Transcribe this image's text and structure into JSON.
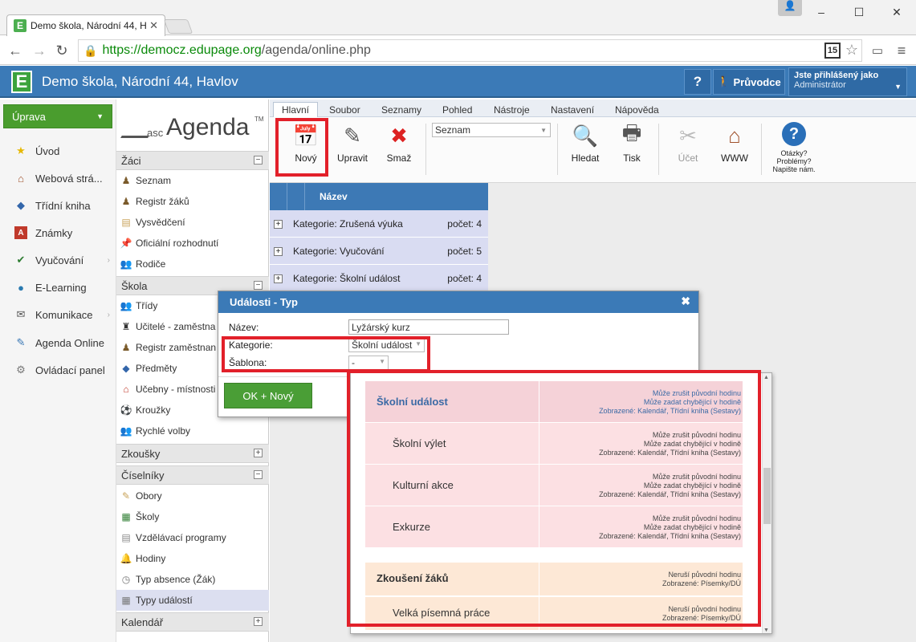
{
  "browser": {
    "tab_title": "Demo škola, Národní 44, H",
    "url_host": "https://democz.edupage.org",
    "url_path": "/agenda/online.php",
    "badge": "15",
    "win_min": "–",
    "win_max": "☐",
    "win_close": "✕"
  },
  "app": {
    "logo": "E",
    "title": "Demo škola, Národní 44, Havlov",
    "help": "?",
    "guide": "Průvodce",
    "login_label": "Jste přihlášený jako",
    "login_user": "Administrátor"
  },
  "leftnav": {
    "edit_button": "Úprava",
    "items": [
      {
        "label": "Úvod",
        "icon": "★"
      },
      {
        "label": "Webová strá...",
        "icon": "⌂"
      },
      {
        "label": "Třídní kniha",
        "icon": "◆"
      },
      {
        "label": "Známky",
        "icon": "A"
      },
      {
        "label": "Vyučování",
        "icon": "✔"
      },
      {
        "label": "E-Learning",
        "icon": "●"
      },
      {
        "label": "Komunikace",
        "icon": "✉"
      },
      {
        "label": "Agenda Online",
        "icon": "✎"
      },
      {
        "label": "Ovládací panel",
        "icon": "⚙"
      }
    ]
  },
  "agenda": {
    "logo_asc": "asc",
    "logo_name": "Agenda",
    "logo_tm": "TM",
    "sections": {
      "zaci": "Žáci",
      "skola": "Škola",
      "zkousky": "Zkoušky",
      "ciselniky": "Číselníky",
      "kalendar": "Kalendář"
    },
    "zaci_items": [
      "Seznam",
      "Registr žáků",
      "Vysvědčení",
      "Oficiální rozhodnutí",
      "Rodiče"
    ],
    "skola_items": [
      "Třídy",
      "Učitelé - zaměstna",
      "Registr zaměstnan",
      "Předměty",
      "Učebny - místnosti",
      "Kroužky",
      "Rychlé volby"
    ],
    "ciselniky_items": [
      "Obory",
      "Školy",
      "Vzdělávací programy",
      "Hodiny",
      "Typ absence (Žák)",
      "Typy událostí"
    ]
  },
  "ribbon": {
    "tabs": [
      "Hlavní",
      "Soubor",
      "Seznamy",
      "Pohled",
      "Nástroje",
      "Nastavení",
      "Nápověda"
    ],
    "buttons": {
      "novy": "Nový",
      "upravit": "Upravit",
      "smaz": "Smaž",
      "hledat": "Hledat",
      "tisk": "Tisk",
      "ucet": "Účet",
      "www": "WWW",
      "help1": "Otázky?",
      "help2": "Problémy?",
      "help3": "Napište nám."
    },
    "select": "Seznam"
  },
  "grid": {
    "header": "Název",
    "rows": [
      {
        "name": "Kategorie: Zrušená výuka",
        "count": "počet: 4"
      },
      {
        "name": "Kategorie: Vyučování",
        "count": "počet: 5"
      },
      {
        "name": "Kategorie: Školní událost",
        "count": "počet: 4"
      }
    ]
  },
  "dialog": {
    "title": "Události - Typ",
    "close": "✖",
    "nazev_label": "Název:",
    "nazev_value": "Lyžárský kurz",
    "kategorie_label": "Kategorie:",
    "kategorie_value": "Školní událost",
    "sablona_label": "Šablona:",
    "sablona_value": "-",
    "ok_button": "OK + Nový"
  },
  "dropdown": {
    "rows": [
      {
        "name": "Školní událost",
        "props": [
          "Může zrušit původní hodinu",
          "Může zadat chybějící v hodině",
          "Zobrazené: Kalendář, Třídní kniha (Sestavy)"
        ]
      },
      {
        "name": "Školní výlet",
        "props": [
          "Může zrušit původní hodinu",
          "Může zadat chybějící v hodině",
          "Zobrazené: Kalendář, Třídní kniha (Sestavy)"
        ]
      },
      {
        "name": "Kulturní akce",
        "props": [
          "Může zrušit původní hodinu",
          "Může zadat chybějící v hodině",
          "Zobrazené: Kalendář, Třídní kniha (Sestavy)"
        ]
      },
      {
        "name": "Exkurze",
        "props": [
          "Může zrušit původní hodinu",
          "Může zadat chybějící v hodině",
          "Zobrazené: Kalendář, Třídní kniha (Sestavy)"
        ]
      },
      {
        "name": "Zkoušení žáků",
        "props": [
          "Neruší původní hodinu",
          "Zobrazené: Písemky/DÚ"
        ]
      },
      {
        "name": "Velká písemná práce",
        "props": [
          "Neruší původní hodinu",
          "Zobrazené: Písemky/DÚ"
        ]
      }
    ]
  },
  "colors": {
    "header_blue": "#3b7ab7",
    "green": "#4a9d2e",
    "highlight_red": "#e2202a",
    "row_lilac": "#d9dcf2",
    "row_pink": "#fce0e3",
    "row_orange": "#fde8d6"
  }
}
